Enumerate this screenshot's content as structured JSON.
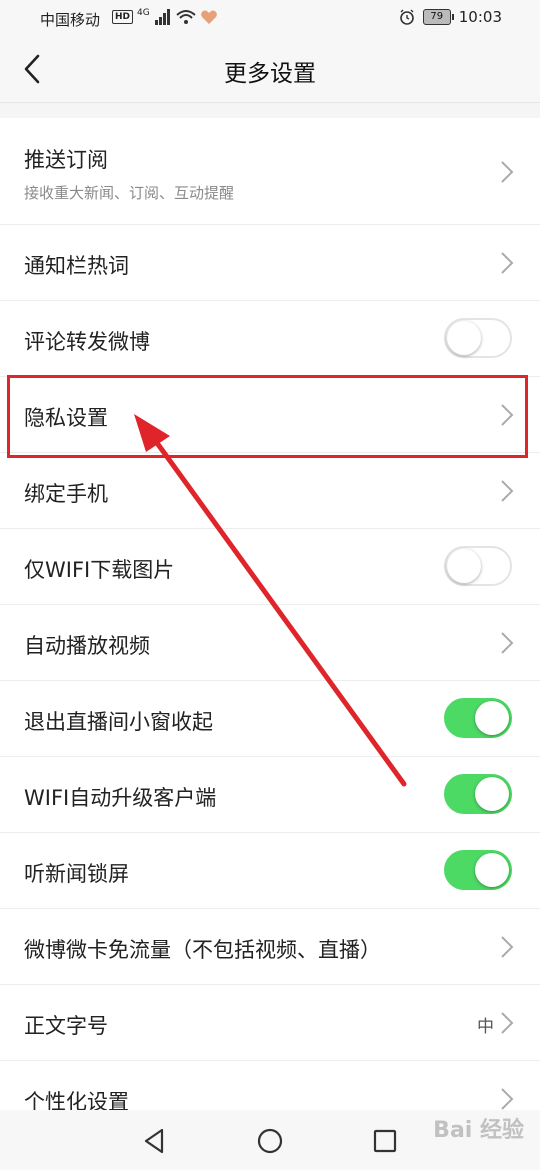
{
  "status_bar": {
    "carrier": "中国移动",
    "hd": "HD",
    "network": "4G",
    "battery": "79",
    "time": "10:03"
  },
  "header": {
    "title": "更多设置",
    "back_icon": "chevron-left-icon"
  },
  "settings": [
    {
      "label": "推送订阅",
      "sublabel": "接收重大新闻、订阅、互动提醒",
      "control": "chevron"
    },
    {
      "label": "通知栏热词",
      "control": "chevron"
    },
    {
      "label": "评论转发微博",
      "control": "toggle",
      "on": false
    },
    {
      "label": "隐私设置",
      "control": "chevron",
      "highlighted": true
    },
    {
      "label": "绑定手机",
      "control": "chevron"
    },
    {
      "label": "仅WIFI下载图片",
      "control": "toggle",
      "on": false
    },
    {
      "label": "自动播放视频",
      "control": "chevron"
    },
    {
      "label": "退出直播间小窗收起",
      "control": "toggle",
      "on": true
    },
    {
      "label": "WIFI自动升级客户端",
      "control": "toggle",
      "on": true
    },
    {
      "label": "听新闻锁屏",
      "control": "toggle",
      "on": true
    },
    {
      "label": "微博微卡免流量（不包括视频、直播）",
      "control": "chevron"
    },
    {
      "label": "正文字号",
      "value": "中",
      "control": "chevron"
    },
    {
      "label": "个性化设置",
      "control": "chevron"
    }
  ],
  "colors": {
    "toggle_on": "#4cd964",
    "highlight": "#e0252a"
  },
  "navbar": {
    "icons": [
      "back-triangle-icon",
      "home-circle-icon",
      "recents-square-icon"
    ]
  },
  "watermark": "Bai 经验"
}
